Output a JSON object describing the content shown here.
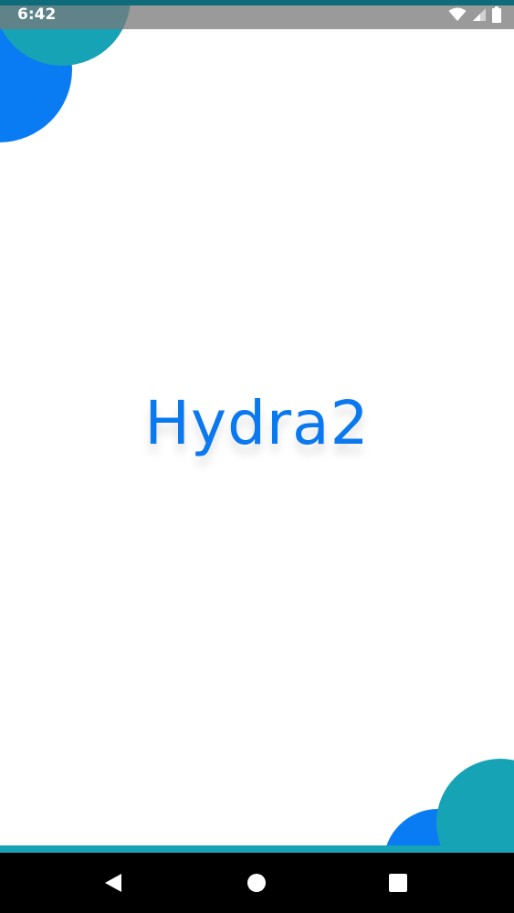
{
  "status_bar": {
    "time": "6:42",
    "icons": [
      "wifi-icon",
      "signal-icon",
      "battery-icon"
    ]
  },
  "splash": {
    "app_name": "Hydra2"
  },
  "colors": {
    "primary_blue": "#0a7cf3",
    "teal": "#17a3b6",
    "title_blue": "#0a78ee"
  },
  "nav_bar": {
    "buttons": [
      "back-icon",
      "home-icon",
      "recents-icon"
    ]
  }
}
